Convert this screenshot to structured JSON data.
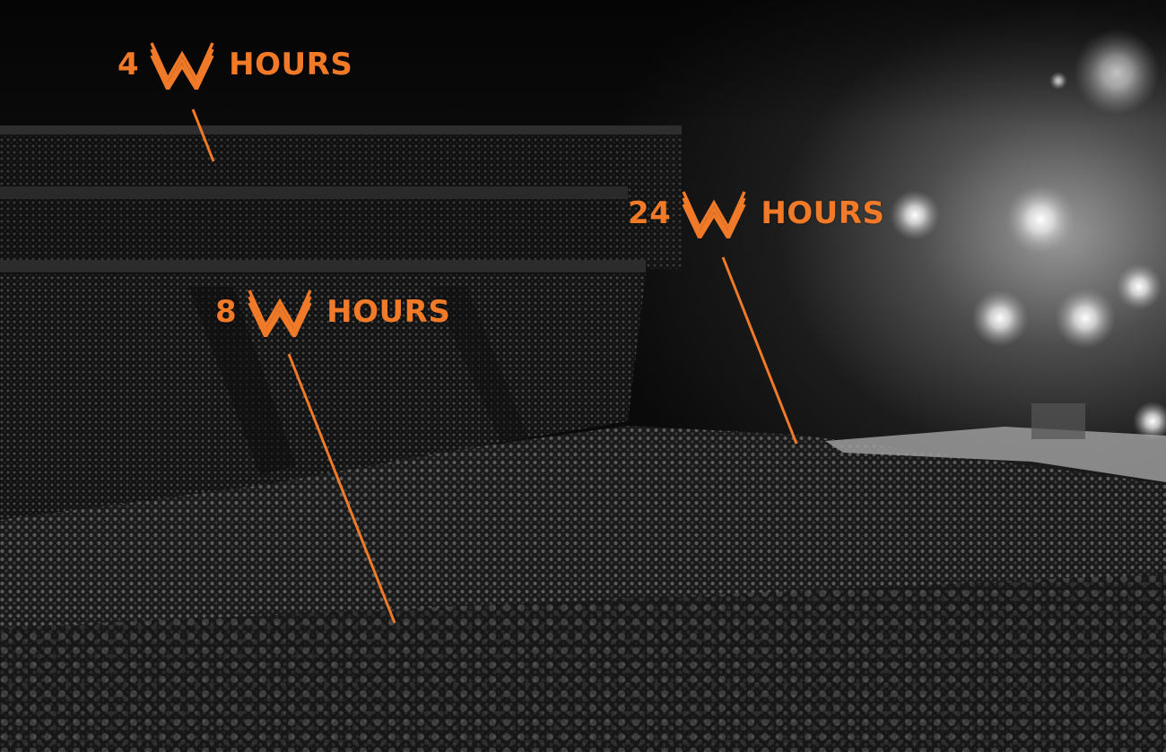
{
  "image": {
    "description_icon": "concert-crowd-arena",
    "accent_color": "#f07a28"
  },
  "callouts": [
    {
      "number": "4",
      "unit": "HOURS",
      "logo": "whataburger-w-logo-icon"
    },
    {
      "number": "8",
      "unit": "HOURS",
      "logo": "whataburger-w-logo-icon"
    },
    {
      "number": "24",
      "unit": "HOURS",
      "logo": "whataburger-w-logo-icon"
    }
  ]
}
